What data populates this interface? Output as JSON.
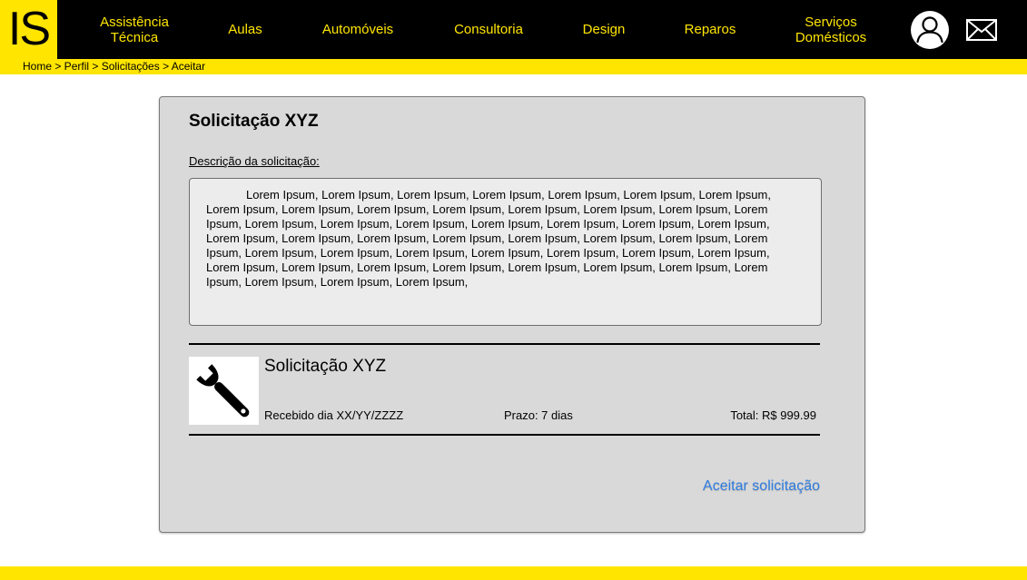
{
  "brand": {
    "logo_text": "IS"
  },
  "nav": {
    "items": [
      {
        "lines": [
          "Assistência",
          "Técnica"
        ]
      },
      {
        "lines": [
          "Aulas"
        ]
      },
      {
        "lines": [
          "Automóveis"
        ]
      },
      {
        "lines": [
          "Consultoria"
        ]
      },
      {
        "lines": [
          "Design"
        ]
      },
      {
        "lines": [
          "Reparos"
        ]
      },
      {
        "lines": [
          "Serviços",
          "Domésticos"
        ]
      }
    ],
    "icons": {
      "profile": "user-avatar-icon",
      "messages": "envelope-icon"
    }
  },
  "breadcrumb": "Home > Perfil > Solicitações > Aceitar",
  "card": {
    "title": "Solicitação XYZ",
    "description_label": "Descrição da solicitação:",
    "description_text": "Lorem Ipsum, Lorem Ipsum, Lorem Ipsum, Lorem Ipsum, Lorem Ipsum, Lorem Ipsum, Lorem Ipsum, Lorem Ipsum, Lorem Ipsum, Lorem Ipsum, Lorem Ipsum, Lorem Ipsum, Lorem Ipsum, Lorem Ipsum, Lorem Ipsum, Lorem Ipsum, Lorem Ipsum, Lorem Ipsum, Lorem Ipsum, Lorem Ipsum, Lorem Ipsum, Lorem Ipsum, Lorem Ipsum, Lorem Ipsum, Lorem Ipsum, Lorem Ipsum, Lorem Ipsum, Lorem Ipsum, Lorem Ipsum, Lorem Ipsum, Lorem Ipsum, Lorem Ipsum, Lorem Ipsum, Lorem Ipsum, Lorem Ipsum, Lorem Ipsum, Lorem Ipsum, Lorem Ipsum, Lorem Ipsum, Lorem Ipsum, Lorem Ipsum, Lorem Ipsum, Lorem Ipsum, Lorem Ipsum, Lorem Ipsum, Lorem Ipsum, Lorem Ipsum, Lorem Ipsum,",
    "request": {
      "icon": "wrench-icon",
      "title": "Solicitação XYZ",
      "received": "Recebido dia XX/YY/ZZZZ",
      "deadline": "Prazo: 7 dias",
      "total": "Total: R$ 999.99"
    },
    "accept_label": "Aceitar solicitação"
  },
  "colors": {
    "brand_yellow": "#ffe500",
    "nav_black": "#000000",
    "card_gray": "#d9d9d9",
    "link_blue": "#2f7de1"
  }
}
